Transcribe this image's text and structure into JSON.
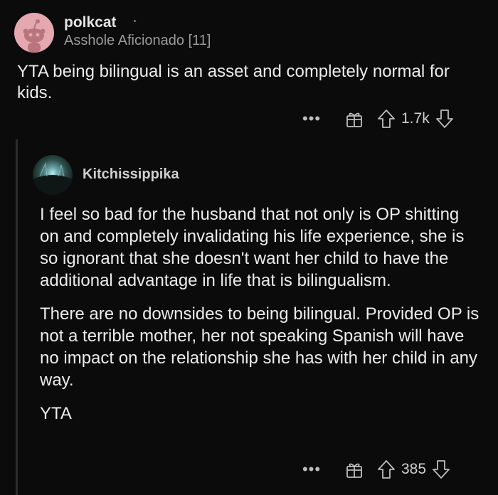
{
  "comment_top": {
    "username": "polkcat",
    "flair": "Asshole Aficionado [11]",
    "text": "YTA  being bilingual is an asset and completely normal for kids.",
    "votes": "1.7k",
    "more_label": "•••"
  },
  "reply": {
    "username": "Kitchissippika",
    "paragraphs": [
      "I feel so bad for the husband that not only is OP shitting on and completely invalidating his life experience, she is so ignorant that she doesn't want her child to have the additional advantage in life that is bilingualism.",
      "There are no downsides to being bilingual. Provided OP is not a terrible mother, her not speaking Spanish will have no impact on the relationship she has with her child in any way.",
      "YTA"
    ],
    "votes": "385",
    "more_label": "•••"
  },
  "colors": {
    "background": "#0b0b0b",
    "text": "#ececec",
    "muted": "#9a9a9a",
    "avatar_pink": "#e6a8b0"
  },
  "icons": [
    "reddit-snoo-avatar-icon",
    "gift-icon",
    "upvote-arrow-icon",
    "downvote-arrow-icon",
    "more-dots-icon"
  ]
}
